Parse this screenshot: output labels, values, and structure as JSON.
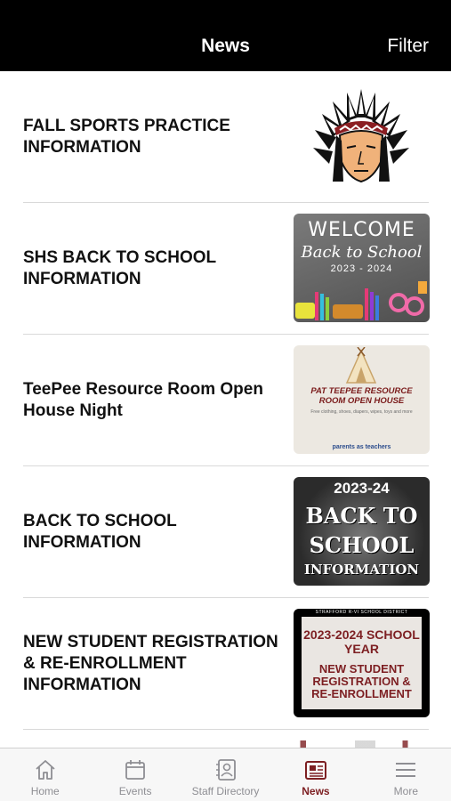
{
  "header": {
    "title": "News",
    "filter_label": "Filter"
  },
  "news": [
    {
      "title": "FALL SPORTS PRACTICE INFORMATION",
      "thumb": "mascot-logo"
    },
    {
      "title": "SHS BACK TO SCHOOL INFORMATION",
      "thumb": "welcome-back-image",
      "thumb_text": {
        "l1": "WELCOME",
        "l2": "Back to School",
        "l3": "2023 - 2024"
      }
    },
    {
      "title": "TeePee Resource Room Open House Night",
      "thumb": "teepee-flyer",
      "thumb_text": {
        "l1": "PAT TEEPEE RESOURCE ROOM OPEN HOUSE",
        "l2": "Free clothing, shoes, diapers, wipes, toys and more",
        "l3": "parents as teachers"
      }
    },
    {
      "title": "BACK TO SCHOOL INFORMATION",
      "thumb": "back-to-school-graphic",
      "thumb_text": {
        "l1": "2023-24",
        "l2": "BACK TO",
        "l3": "SCHOOL",
        "l4": "INFORMATION"
      }
    },
    {
      "title": "NEW STUDENT REGISTRATION & RE-ENROLLMENT INFORMATION",
      "thumb": "registration-graphic",
      "thumb_text": {
        "l0": "STRAFFORD R-VI SCHOOL DISTRICT",
        "l1": "2023-2024 SCHOOL YEAR",
        "l2": "NEW STUDENT REGISTRATION & RE-ENROLLMENT"
      }
    }
  ],
  "tabs": [
    {
      "label": "Home",
      "icon": "home-icon",
      "active": false
    },
    {
      "label": "Events",
      "icon": "calendar-icon",
      "active": false
    },
    {
      "label": "Staff Directory",
      "icon": "staff-directory-icon",
      "active": false
    },
    {
      "label": "News",
      "icon": "newspaper-icon",
      "active": true
    },
    {
      "label": "More",
      "icon": "menu-icon",
      "active": false
    }
  ],
  "colors": {
    "accent": "#7d1f22",
    "header_bg": "#000000",
    "inactive_tab": "#8e8e93"
  }
}
